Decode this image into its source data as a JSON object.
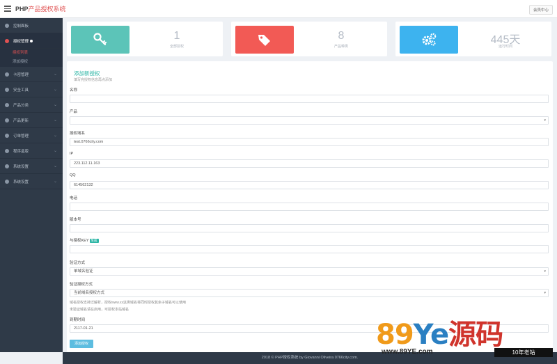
{
  "header": {
    "brand_main": "PHP",
    "brand_accent": "产品授权系统",
    "user_menu": "会员中心"
  },
  "sidebar": {
    "items": [
      {
        "label": "控制面板"
      },
      {
        "label": "授权管理",
        "active": true,
        "sub": [
          {
            "label": "授权列表"
          },
          {
            "label": "添加授权"
          }
        ]
      },
      {
        "label": "卡密管理"
      },
      {
        "label": "安全工具"
      },
      {
        "label": "产品分类"
      },
      {
        "label": "产品更新"
      },
      {
        "label": "订单管理"
      },
      {
        "label": "程序盗版"
      },
      {
        "label": "系统设置"
      },
      {
        "label": "系统设置"
      }
    ]
  },
  "stats": [
    {
      "value": "1",
      "label": "全部授权",
      "color": "#5cc4b8",
      "icon": "key-icon"
    },
    {
      "value": "8",
      "label": "产品种类",
      "color": "#f25a55",
      "icon": "tag-icon"
    },
    {
      "value": "445天",
      "label": "运行时间",
      "color": "#3db3ef",
      "icon": "gears-icon"
    }
  ],
  "form": {
    "title": "添加新授权",
    "subtitle": "填写完授权信息再点添加",
    "fields": [
      {
        "label": "名称",
        "value": ""
      },
      {
        "label": "产品",
        "value": "",
        "type": "select"
      },
      {
        "label": "授权域名",
        "value": "test.0766city.com"
      },
      {
        "label": "IP",
        "value": "223.112.11.163"
      },
      {
        "label": "QQ",
        "value": "614562132"
      },
      {
        "label": "电话",
        "value": ""
      },
      {
        "label": "版本号",
        "value": ""
      },
      {
        "label": "与授权KEY",
        "badge": "生成",
        "value": ""
      },
      {
        "label": "验证方式",
        "value": "单域名验证",
        "type": "select"
      },
      {
        "label": "验证授权方式",
        "value": "当前域名授权方式",
        "type": "select"
      }
    ],
    "hint1": "域名授权支持泛解析，授权www.xx这类域名将同时授权其余子域名可以使用",
    "hint2": "未验证域名请在启用，可授权本站域名",
    "expire_label": "到期时间",
    "expire_value": "2117-01-21",
    "submit": "添加授权"
  },
  "footer": "2018 © PHP授权系统 by Giovanni Oliveira 0766city.com.",
  "watermark": {
    "main_89": "89",
    "main_ye": "Ye",
    "main_src": "源码",
    "url": "www.89YE.com",
    "tag": "10年老站"
  }
}
